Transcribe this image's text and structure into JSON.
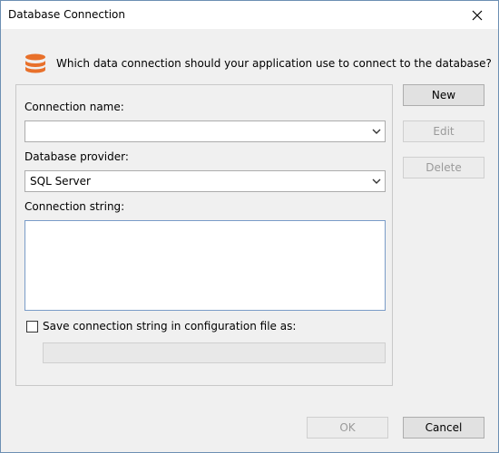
{
  "window": {
    "title": "Database Connection"
  },
  "prompt": {
    "text": "Which data connection should your application use to connect to the database?",
    "icon": "database-icon",
    "icon_color": "#e8702a"
  },
  "form": {
    "connection_name_label": "Connection name:",
    "connection_name_value": "",
    "provider_label": "Database provider:",
    "provider_value": "SQL Server",
    "connection_string_label": "Connection string:",
    "connection_string_value": "",
    "save_checkbox_label": "Save connection string in configuration file as:",
    "save_checkbox_checked": false,
    "config_name_value": ""
  },
  "side_buttons": {
    "new_label": "New",
    "edit_label": "Edit",
    "delete_label": "Delete"
  },
  "footer": {
    "ok_label": "OK",
    "cancel_label": "Cancel"
  }
}
